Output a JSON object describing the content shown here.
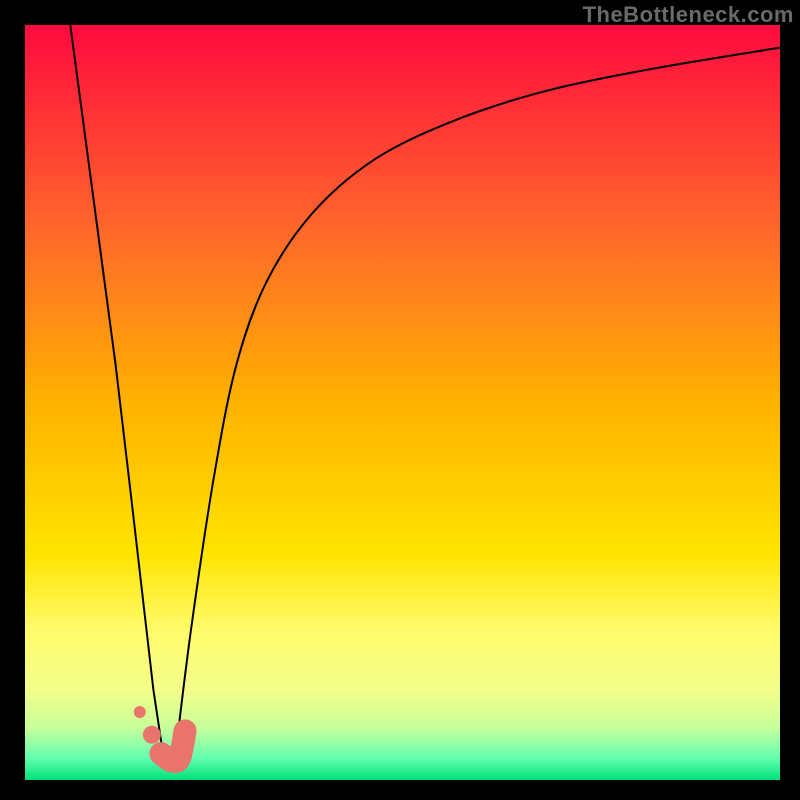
{
  "watermark": {
    "text": "TheBottleneck.com"
  },
  "chart_data": {
    "type": "line",
    "title": "",
    "xlabel": "",
    "ylabel": "",
    "xlim": [
      0,
      100
    ],
    "ylim": [
      0,
      100
    ],
    "axes_visible": false,
    "legend": false,
    "background": {
      "type": "vertical-gradient",
      "stops": [
        {
          "pos": 0.0,
          "color": "#ff0a3e"
        },
        {
          "pos": 0.28,
          "color": "#ff6a2a"
        },
        {
          "pos": 0.5,
          "color": "#ffb200"
        },
        {
          "pos": 0.7,
          "color": "#ffe400"
        },
        {
          "pos": 0.8,
          "color": "#fffb6a"
        },
        {
          "pos": 0.88,
          "color": "#f3ff8a"
        },
        {
          "pos": 0.93,
          "color": "#c9ff9a"
        },
        {
          "pos": 0.97,
          "color": "#66ffb0"
        },
        {
          "pos": 1.0,
          "color": "#00e07a"
        }
      ]
    },
    "series": [
      {
        "name": "left-branch",
        "color": "#000000",
        "width": 2,
        "x": [
          6,
          8,
          10,
          12,
          14,
          15.5,
          17,
          18.2
        ],
        "y": [
          100,
          85,
          70,
          55,
          38,
          25,
          12,
          4
        ]
      },
      {
        "name": "right-branch",
        "color": "#000000",
        "width": 2,
        "x": [
          20,
          22,
          25,
          28,
          32,
          38,
          46,
          56,
          68,
          82,
          100
        ],
        "y": [
          4,
          20,
          40,
          55,
          66,
          75,
          82,
          87,
          91,
          94,
          97
        ]
      },
      {
        "name": "marker-cluster",
        "color": "#e8746b",
        "type": "thick-scatter",
        "x": [
          15.2,
          16.8,
          18.0,
          19.5,
          20.5,
          21.2
        ],
        "y": [
          9,
          6,
          3.5,
          2.5,
          3.0,
          6.5
        ]
      }
    ],
    "optimum_x": 19
  },
  "frame": {
    "outer_size": 800,
    "plot_inset_top": 25,
    "plot_inset_left": 25,
    "plot_inset_right": 20,
    "plot_inset_bottom": 20,
    "frame_color": "#000000"
  }
}
